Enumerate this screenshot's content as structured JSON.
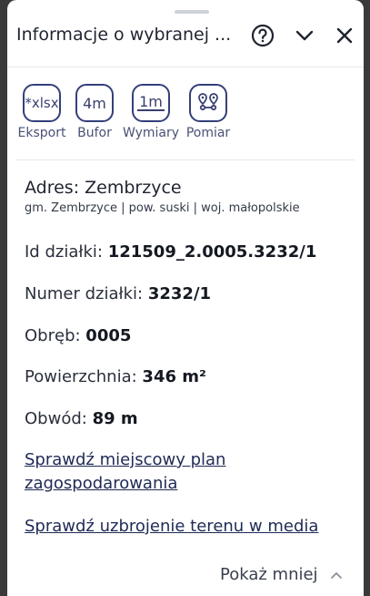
{
  "header": {
    "title": "Informacje o wybranej ...",
    "help_icon": "help-circle-icon",
    "collapse_icon": "chevron-down-icon",
    "close_icon": "close-icon"
  },
  "tools": [
    {
      "icon_text": "*xlsx",
      "label": "Eksport"
    },
    {
      "icon_text": "4m",
      "label": "Bufor"
    },
    {
      "icon_text": "1m",
      "label": "Wymiary"
    },
    {
      "icon": "location-pins-icon",
      "label": "Pomiar"
    }
  ],
  "address": {
    "title": "Adres: Zembrzyce",
    "subtitle": "gm. Zembrzyce | pow. suski | woj. małopolskie"
  },
  "fields": [
    {
      "label": "Id działki:",
      "value": "121509_2.0005.3232/1"
    },
    {
      "label": "Numer działki:",
      "value": "3232/1"
    },
    {
      "label": "Obręb:",
      "value": "0005"
    },
    {
      "label": "Powierzchnia:",
      "value": "346 m²"
    },
    {
      "label": "Obwód:",
      "value": "89 m"
    }
  ],
  "links": {
    "plan": "Sprawdź miejscowy plan zagospodarowania",
    "media": "Sprawdź uzbrojenie terenu w media"
  },
  "footer": {
    "show_less": "Pokaż mniej"
  }
}
